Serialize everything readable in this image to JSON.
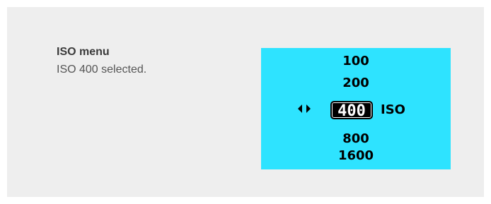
{
  "caption": {
    "title": "ISO menu",
    "text": "ISO 400 selected."
  },
  "lcd": {
    "background_color": "#2ee3ff",
    "options": [
      "100",
      "200",
      "400",
      "800",
      "1600"
    ],
    "selected_value": "400",
    "unit_label": "ISO",
    "selector_icon": "left-right-arrows-icon"
  }
}
